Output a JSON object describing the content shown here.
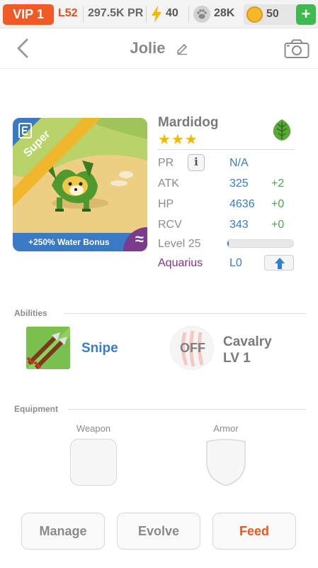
{
  "status_bar": {
    "vip": "VIP 1",
    "level": "L52",
    "pr": "297.5K PR",
    "energy": "40",
    "paws": "28K",
    "coins": "50",
    "plus": "+"
  },
  "header": {
    "title": "Jolie",
    "back_icon": "chevron-left-icon",
    "edit_icon": "pencil-icon",
    "camera_icon": "camera-icon"
  },
  "pet": {
    "rarity": "Super",
    "bonus": "+250% Water Bonus",
    "element_symbol": "≈",
    "name": "Mardidog",
    "stars": "★★★",
    "element_icon": "leaf-icon"
  },
  "stats": {
    "pr": {
      "label": "PR",
      "value": "N/A",
      "info": "i"
    },
    "atk": {
      "label": "ATK",
      "value": "325",
      "bonus": "+2"
    },
    "hp": {
      "label": "HP",
      "value": "4636",
      "bonus": "+0"
    },
    "rcv": {
      "label": "RCV",
      "value": "343",
      "bonus": "+0"
    },
    "level": {
      "label": "Level 25",
      "xp_progress": 0.02
    },
    "zodiac": {
      "label": "Aquarius",
      "value": "L0"
    }
  },
  "abilities": {
    "section_label": "Abilities",
    "ability": "Snipe",
    "skill_status": "OFF",
    "skill_name_line1": "Cavalry",
    "skill_name_line2": "LV 1"
  },
  "equipment": {
    "section_label": "Equipment",
    "weapon_label": "Weapon",
    "armor_label": "Armor"
  },
  "actions": {
    "manage": "Manage",
    "evolve": "Evolve",
    "feed": "Feed"
  },
  "colors": {
    "vip": "#f15a24",
    "accent_blue": "#3a7cc8",
    "bonus_green": "#49a84f",
    "zodiac_purple": "#8b2f8c",
    "feed_orange": "#e55a1c"
  }
}
